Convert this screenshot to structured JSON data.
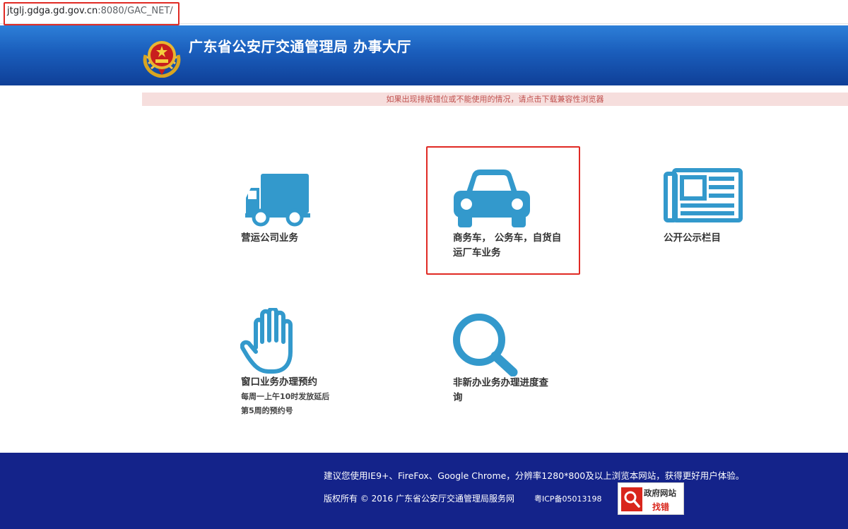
{
  "browser": {
    "url_host": "jtglj.gdga.gd.gov.cn",
    "url_path": ":8080/GAC_NET/"
  },
  "header": {
    "title": "广东省公安厅交通管理局 办事大厅"
  },
  "notice": "如果出现排版错位或不能使用的情况，请点击下载兼容性浏览器",
  "tiles": [
    {
      "icon": "truck-icon",
      "label": "营运公司业务"
    },
    {
      "icon": "car-icon",
      "label_line1": "商务车， 公务车，自货自",
      "label_line2": "运厂车业务"
    },
    {
      "icon": "newspaper-icon",
      "label": "公开公示栏目"
    },
    {
      "icon": "hand-icon",
      "label": "窗口业务办理预约",
      "sub_line1": "每周一上午10时发放延后",
      "sub_line2": "第5周的预约号"
    },
    {
      "icon": "search-icon",
      "label_line1": "非新办业务办理进度查",
      "label_line2": "询"
    }
  ],
  "footer": {
    "line1": "建议您使用IE9+、FireFox、Google Chrome，分辨率1280*800及以上浏览本网站，获得更好用户体验。",
    "copyright": "版权所有 © 2016 广东省公安厅交通管理局服务网",
    "icp": "粤ICP备05013198",
    "badge_line1": "政府网站",
    "badge_line2": "找错"
  },
  "colors": {
    "icon_blue": "#3399cc",
    "header_blue": "#1a5dbb",
    "footer_navy": "#14238a",
    "highlight_red": "#e02a24"
  }
}
